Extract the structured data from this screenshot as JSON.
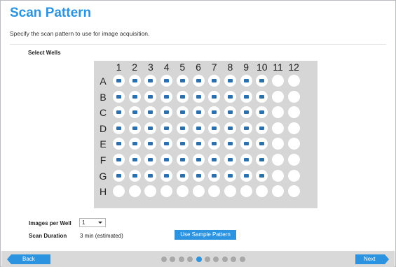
{
  "title": "Scan Pattern",
  "subtitle": "Specify the scan pattern to use for image acquisition.",
  "select_wells_label": "Select Wells",
  "plate": {
    "columns": [
      "1",
      "2",
      "3",
      "4",
      "5",
      "6",
      "7",
      "8",
      "9",
      "10",
      "11",
      "12"
    ],
    "rows": [
      "A",
      "B",
      "C",
      "D",
      "E",
      "F",
      "G",
      "H"
    ],
    "selected_rows": [
      "A",
      "B",
      "C",
      "D",
      "E",
      "F",
      "G"
    ],
    "selected_columns": [
      "1",
      "2",
      "3",
      "4",
      "5",
      "6",
      "7",
      "8",
      "9",
      "10"
    ]
  },
  "images_per_well": {
    "label": "Images per Well",
    "value": "1"
  },
  "scan_duration": {
    "label": "Scan Duration",
    "value": "3 min (estimated)"
  },
  "use_sample_pattern_label": "Use Sample Pattern",
  "nav": {
    "back_label": "Back",
    "next_label": "Next",
    "page_count": 10,
    "current_page": 4
  },
  "colors": {
    "accent": "#2b93e0",
    "well_mark": "#2a6fae",
    "plate_bg": "#d6d6d6"
  }
}
